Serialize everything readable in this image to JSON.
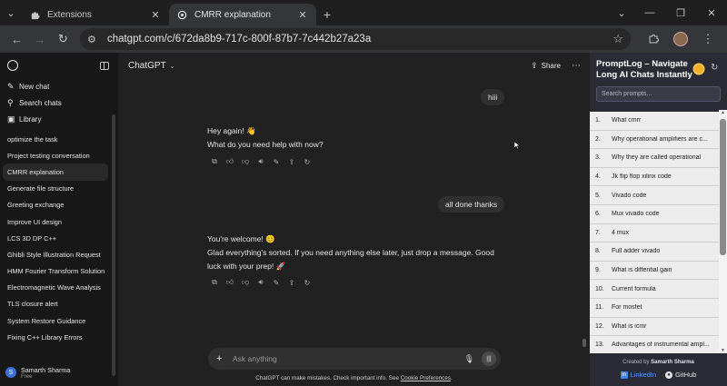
{
  "browser": {
    "tabs": [
      {
        "title": "Extensions",
        "icon": "puzzle-icon"
      },
      {
        "title": "CMRR explanation",
        "icon": "chatgpt-icon"
      }
    ],
    "url": "chatgpt.com/c/672da8b9-717c-800f-87b7-7c442b27a23a"
  },
  "sidebar": {
    "actions": [
      {
        "label": "New chat",
        "icon": "new-chat-icon"
      },
      {
        "label": "Search chats",
        "icon": "search-icon"
      },
      {
        "label": "Library",
        "icon": "library-icon"
      }
    ],
    "chats": [
      "optimize the task",
      "Project testing conversation",
      "CMRR explanation",
      "Generate file structure",
      "Greeting exchange",
      "Improve UI design",
      "LCS 3D DP C++",
      "Ghibli Style Illustration Request",
      "HMM Fourier Transform Solution",
      "Electromagnetic Wave Analysis",
      "TLS closure alert",
      "System Restore Guidance",
      "Fixing C++ Library Errors"
    ],
    "user": {
      "initial": "S",
      "name": "Samarth Sharma",
      "plan": "Free"
    }
  },
  "main": {
    "model": "ChatGPT",
    "share_label": "Share",
    "messages": [
      {
        "role": "user",
        "text": "hiii"
      },
      {
        "role": "assistant",
        "lines": [
          "Hey again! 👋",
          "What do you need help with now?"
        ]
      },
      {
        "role": "user",
        "text": "all done thanks"
      },
      {
        "role": "assistant",
        "lines": [
          "You're welcome! 😊",
          "Glad everything's sorted. If you need anything else later, just drop a message. Good luck with your prep! 🚀"
        ]
      }
    ],
    "composer_placeholder": "Ask anything",
    "disclaimer": "ChatGPT can make mistakes. Check important info. See",
    "disclaimer_link": "Cookie Preferences",
    "disclaimer_end": "."
  },
  "promptlog": {
    "title": "PromptLog – Navigate Long AI Chats Instantly",
    "search_placeholder": "Search prompts...",
    "items": [
      "What cmrr",
      "Why operational amplifiers are c...",
      "Why they are called operational",
      "Jk flip flop xilinx code",
      "Vivado code",
      "Mux vivado code",
      "4 mux",
      "Full adder vivado",
      "What is diffential gain",
      "Current formula",
      "For mosfet",
      "What is icmr",
      "Advantages of instrumental ampl..."
    ],
    "credit_prefix": "Created by",
    "credit_name": "Samarth Sharma",
    "linkedin": "LinkedIn",
    "github": "GitHub"
  }
}
